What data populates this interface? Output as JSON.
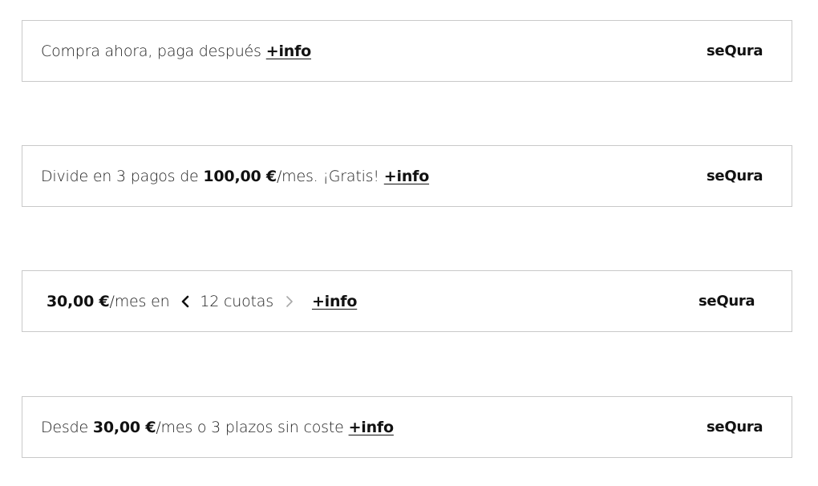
{
  "widgets": [
    {
      "text_main": "Compra ahora, paga después",
      "info_link": "+info",
      "brand": "seQura"
    },
    {
      "text_prefix": "Divide en 3 pagos de ",
      "amount": "100,00 €",
      "text_suffix": "/mes. ¡Gratis!",
      "info_link": "+info",
      "brand": "seQura"
    },
    {
      "amount": "30,00 €",
      "text_suffix": "/mes en",
      "installments": "12 cuotas",
      "info_link": "+info",
      "brand": "seQura",
      "prev_icon": "chevron-left-icon",
      "next_icon": "chevron-right-icon"
    },
    {
      "text_prefix": "Desde ",
      "amount": "30,00 €",
      "text_suffix": "/mes o 3 plazos sin coste",
      "info_link": "+info",
      "brand": "seQura"
    }
  ],
  "colors": {
    "border": "#c9c9c9",
    "text": "#222222",
    "chevron_active": "#111111",
    "chevron_inactive": "#a8a8a8"
  }
}
